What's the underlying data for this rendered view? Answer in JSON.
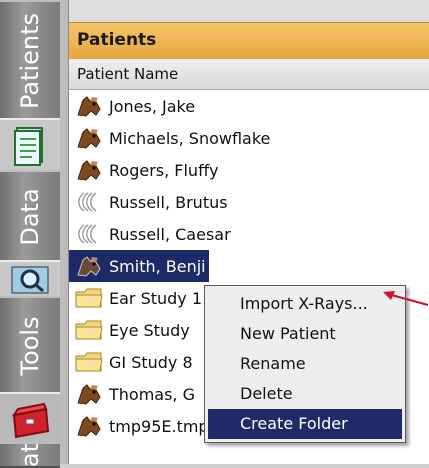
{
  "tabs": {
    "patients": "Patients",
    "data": "Data",
    "tools": "Tools",
    "stats_partial": "at"
  },
  "panel": {
    "title": "Patients",
    "column_header": "Patient Name"
  },
  "rows": [
    {
      "label": "Jones, Jake",
      "icon": "dog-icon"
    },
    {
      "label": "Michaels, Snowflake",
      "icon": "dog-icon"
    },
    {
      "label": "Rogers, Fluffy",
      "icon": "dog-icon"
    },
    {
      "label": "Russell, Brutus",
      "icon": "xray-icon"
    },
    {
      "label": "Russell, Caesar",
      "icon": "xray-icon"
    },
    {
      "label": "Smith, Benji",
      "icon": "dog-icon",
      "selected": true
    },
    {
      "label": "Ear Study 1",
      "icon": "folder-icon"
    },
    {
      "label": "Eye Study",
      "icon": "folder-icon"
    },
    {
      "label": "GI Study 8",
      "icon": "folder-icon"
    },
    {
      "label": "Thomas, G",
      "icon": "dog-icon"
    },
    {
      "label": "tmp95E.tmp",
      "icon": "dog-icon"
    }
  ],
  "context_menu": {
    "items": [
      "Import X-Rays...",
      "New Patient",
      "Rename",
      "Delete",
      "Create Folder"
    ],
    "active_index": 4
  },
  "colors": {
    "header_orange": "#e7a63b",
    "selection_navy": "#1e2a67",
    "annotation_arrow": "#d0112b"
  }
}
